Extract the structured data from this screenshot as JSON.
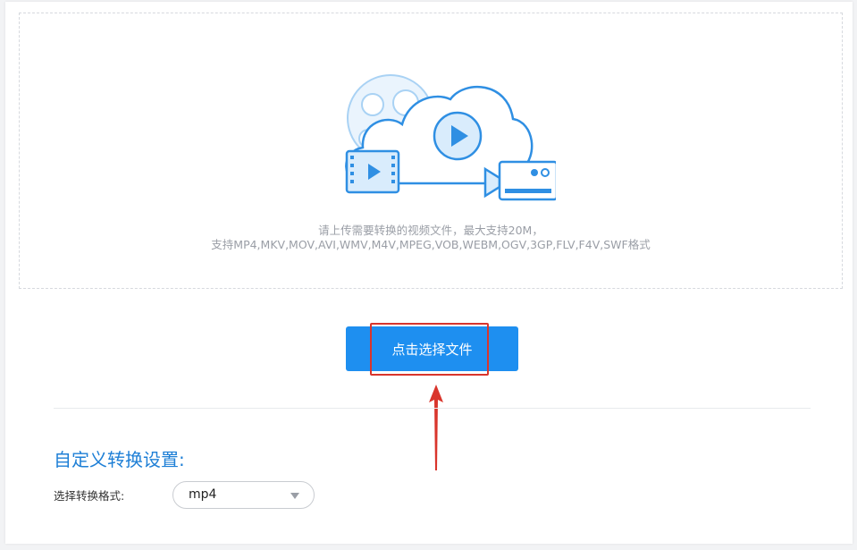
{
  "upload": {
    "hint_line1": "请上传需要转换的视频文件，最大支持20M，",
    "hint_line2": "支持MP4,MKV,MOV,AVI,WMV,M4V,MPEG,VOB,WEBM,OGV,3GP,FLV,F4V,SWF格式",
    "illustration_icon": "cloud-video-upload-icon"
  },
  "select_button": {
    "label": "点击选择文件"
  },
  "settings": {
    "title": "自定义转换设置:",
    "format_label": "选择转换格式:",
    "format_value": "mp4"
  },
  "colors": {
    "primary": "#1e8ff0",
    "highlight": "#d9352c",
    "title": "#1e7fd6"
  }
}
